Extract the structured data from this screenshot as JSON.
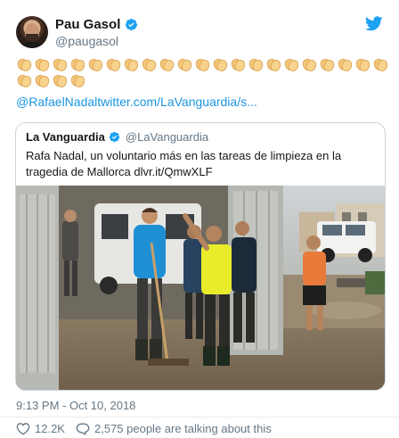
{
  "author": {
    "name": "Pau Gasol",
    "handle": "@paugasol"
  },
  "tweet": {
    "emoji": "clapping-hands",
    "emoji_count": 25,
    "link": "@RafaelNadaltwitter.com/LaVanguardia/s..."
  },
  "quoted": {
    "name": "La Vanguardia",
    "handle": "@LaVanguardia",
    "text": "Rafa Nadal, un voluntario más en las tareas de limpieza en la tragedia de Mallorca dlvr.it/QmwXLF"
  },
  "meta": {
    "timestamp": "9:13 PM - Oct 10, 2018",
    "likes": "12.2K",
    "talking": "2,575 people are talking about this"
  },
  "colors": {
    "twitter_blue": "#1da1f2",
    "link": "#1b95e0",
    "muted": "#657786",
    "border": "#ccd6dd"
  }
}
